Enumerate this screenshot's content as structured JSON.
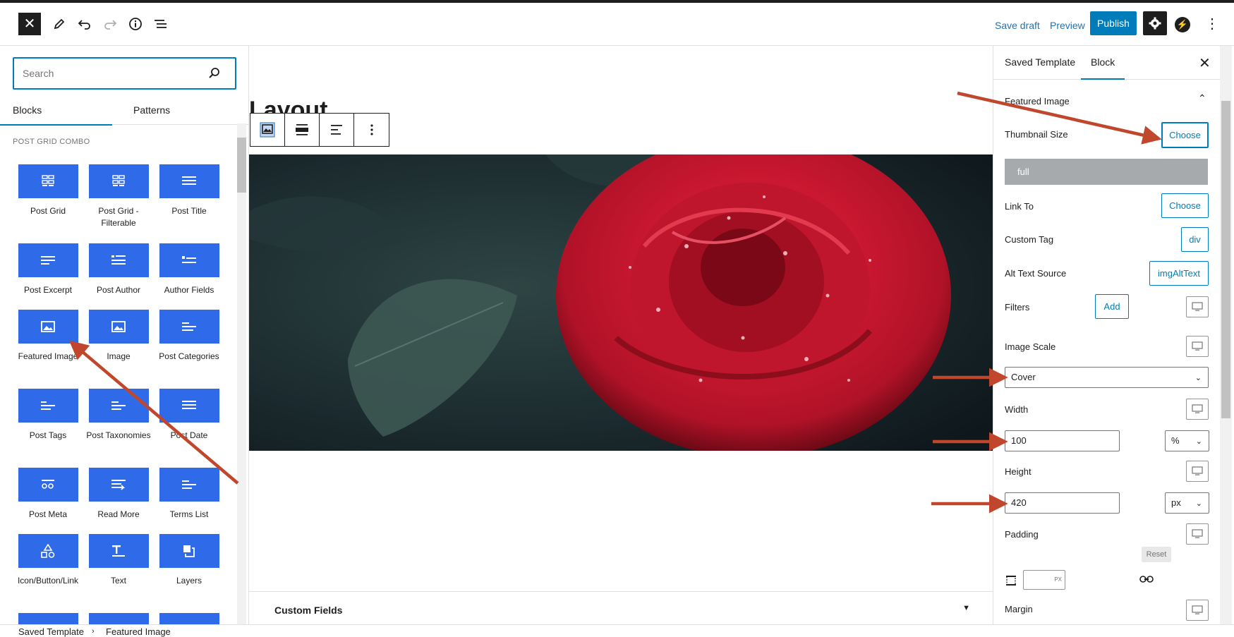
{
  "topbar": {
    "save_draft": "Save draft",
    "preview": "Preview",
    "publish": "Publish",
    "more_label": "⋮"
  },
  "inserter": {
    "search_placeholder": "Search",
    "tabs": [
      "Blocks",
      "Patterns"
    ],
    "category": "POST GRID COMBO",
    "blocks": [
      {
        "label": "Post Grid",
        "icon": "grid-icon"
      },
      {
        "label": "Post Grid - Filterable",
        "icon": "grid-icon"
      },
      {
        "label": "Post Title",
        "icon": "title-lines-icon"
      },
      {
        "label": "Post Excerpt",
        "icon": "excerpt-lines-icon"
      },
      {
        "label": "Post Author",
        "icon": "author-icon"
      },
      {
        "label": "Author Fields",
        "icon": "author-fields-icon"
      },
      {
        "label": "Featured Image",
        "icon": "image-icon"
      },
      {
        "label": "Image",
        "icon": "image-icon"
      },
      {
        "label": "Post Categories",
        "icon": "categories-icon"
      },
      {
        "label": "Post Tags",
        "icon": "tags-icon"
      },
      {
        "label": "Post Taxonomies",
        "icon": "taxonomies-icon"
      },
      {
        "label": "Post Date",
        "icon": "date-lines-icon"
      },
      {
        "label": "Post Meta",
        "icon": "meta-icon"
      },
      {
        "label": "Read More",
        "icon": "read-more-icon"
      },
      {
        "label": "Terms List",
        "icon": "terms-icon"
      },
      {
        "label": "Icon/Button/Link",
        "icon": "shapes-icon"
      },
      {
        "label": "Text",
        "icon": "text-icon"
      },
      {
        "label": "Layers",
        "icon": "layers-icon"
      }
    ]
  },
  "editor": {
    "title_partial": "Layout",
    "custom_fields": "Custom Fields"
  },
  "sidebar": {
    "tabs": [
      "Saved Template",
      "Block"
    ],
    "panel_title": "Featured Image",
    "thumbnail_size_label": "Thumbnail Size",
    "thumbnail_size_btn": "Choose",
    "thumbnail_value": "full",
    "link_to_label": "Link To",
    "link_to_btn": "Choose",
    "custom_tag_label": "Custom Tag",
    "custom_tag_value": "div",
    "alt_text_label": "Alt Text Source",
    "alt_text_value": "imgAltText",
    "filters_label": "Filters",
    "filters_btn": "Add",
    "image_scale_label": "Image Scale",
    "image_scale_value": "Cover",
    "width_label": "Width",
    "width_value": "100",
    "width_unit": "%",
    "height_label": "Height",
    "height_value": "420",
    "height_unit": "px",
    "padding_label": "Padding",
    "padding_reset": "Reset",
    "padding_unit": "PX",
    "margin_label": "Margin"
  },
  "breadcrumb": [
    "Saved Template",
    "Featured Image"
  ],
  "colors": {
    "accent": "#007cba",
    "block_icon_bg": "#2f6be8",
    "annotation_arrow": "#c0462c"
  }
}
